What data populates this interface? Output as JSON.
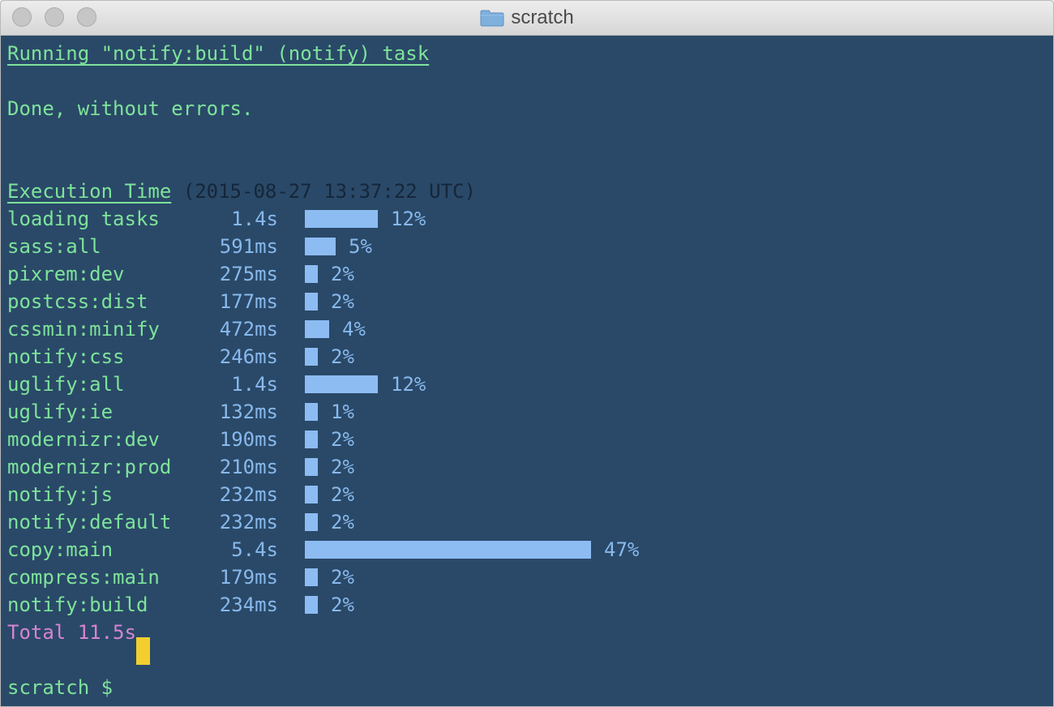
{
  "window": {
    "title": "scratch"
  },
  "terminal": {
    "running_line": "Running \"notify:build\" (notify) task",
    "done_line": "Done, without errors.",
    "exec_heading": "Execution Time",
    "exec_timestamp": " (2015-08-27 13:37:22 UTC)",
    "rows": [
      {
        "task": "loading tasks",
        "time": "1.4s",
        "pct_label": "12%",
        "pct": 12
      },
      {
        "task": "sass:all",
        "time": "591ms",
        "pct_label": "5%",
        "pct": 5
      },
      {
        "task": "pixrem:dev",
        "time": "275ms",
        "pct_label": "2%",
        "pct": 2
      },
      {
        "task": "postcss:dist",
        "time": "177ms",
        "pct_label": "2%",
        "pct": 2
      },
      {
        "task": "cssmin:minify",
        "time": "472ms",
        "pct_label": "4%",
        "pct": 4
      },
      {
        "task": "notify:css",
        "time": "246ms",
        "pct_label": "2%",
        "pct": 2
      },
      {
        "task": "uglify:all",
        "time": "1.4s",
        "pct_label": "12%",
        "pct": 12
      },
      {
        "task": "uglify:ie",
        "time": "132ms",
        "pct_label": "1%",
        "pct": 1
      },
      {
        "task": "modernizr:dev",
        "time": "190ms",
        "pct_label": "2%",
        "pct": 2
      },
      {
        "task": "modernizr:prod",
        "time": "210ms",
        "pct_label": "2%",
        "pct": 2
      },
      {
        "task": "notify:js",
        "time": "232ms",
        "pct_label": "2%",
        "pct": 2
      },
      {
        "task": "notify:default",
        "time": "232ms",
        "pct_label": "2%",
        "pct": 2
      },
      {
        "task": "copy:main",
        "time": "5.4s",
        "pct_label": "47%",
        "pct": 47
      },
      {
        "task": "compress:main",
        "time": "179ms",
        "pct_label": "2%",
        "pct": 2
      },
      {
        "task": "notify:build",
        "time": "234ms",
        "pct_label": "2%",
        "pct": 2
      }
    ],
    "total_line": "Total 11.5s",
    "prompt": "scratch $ "
  }
}
